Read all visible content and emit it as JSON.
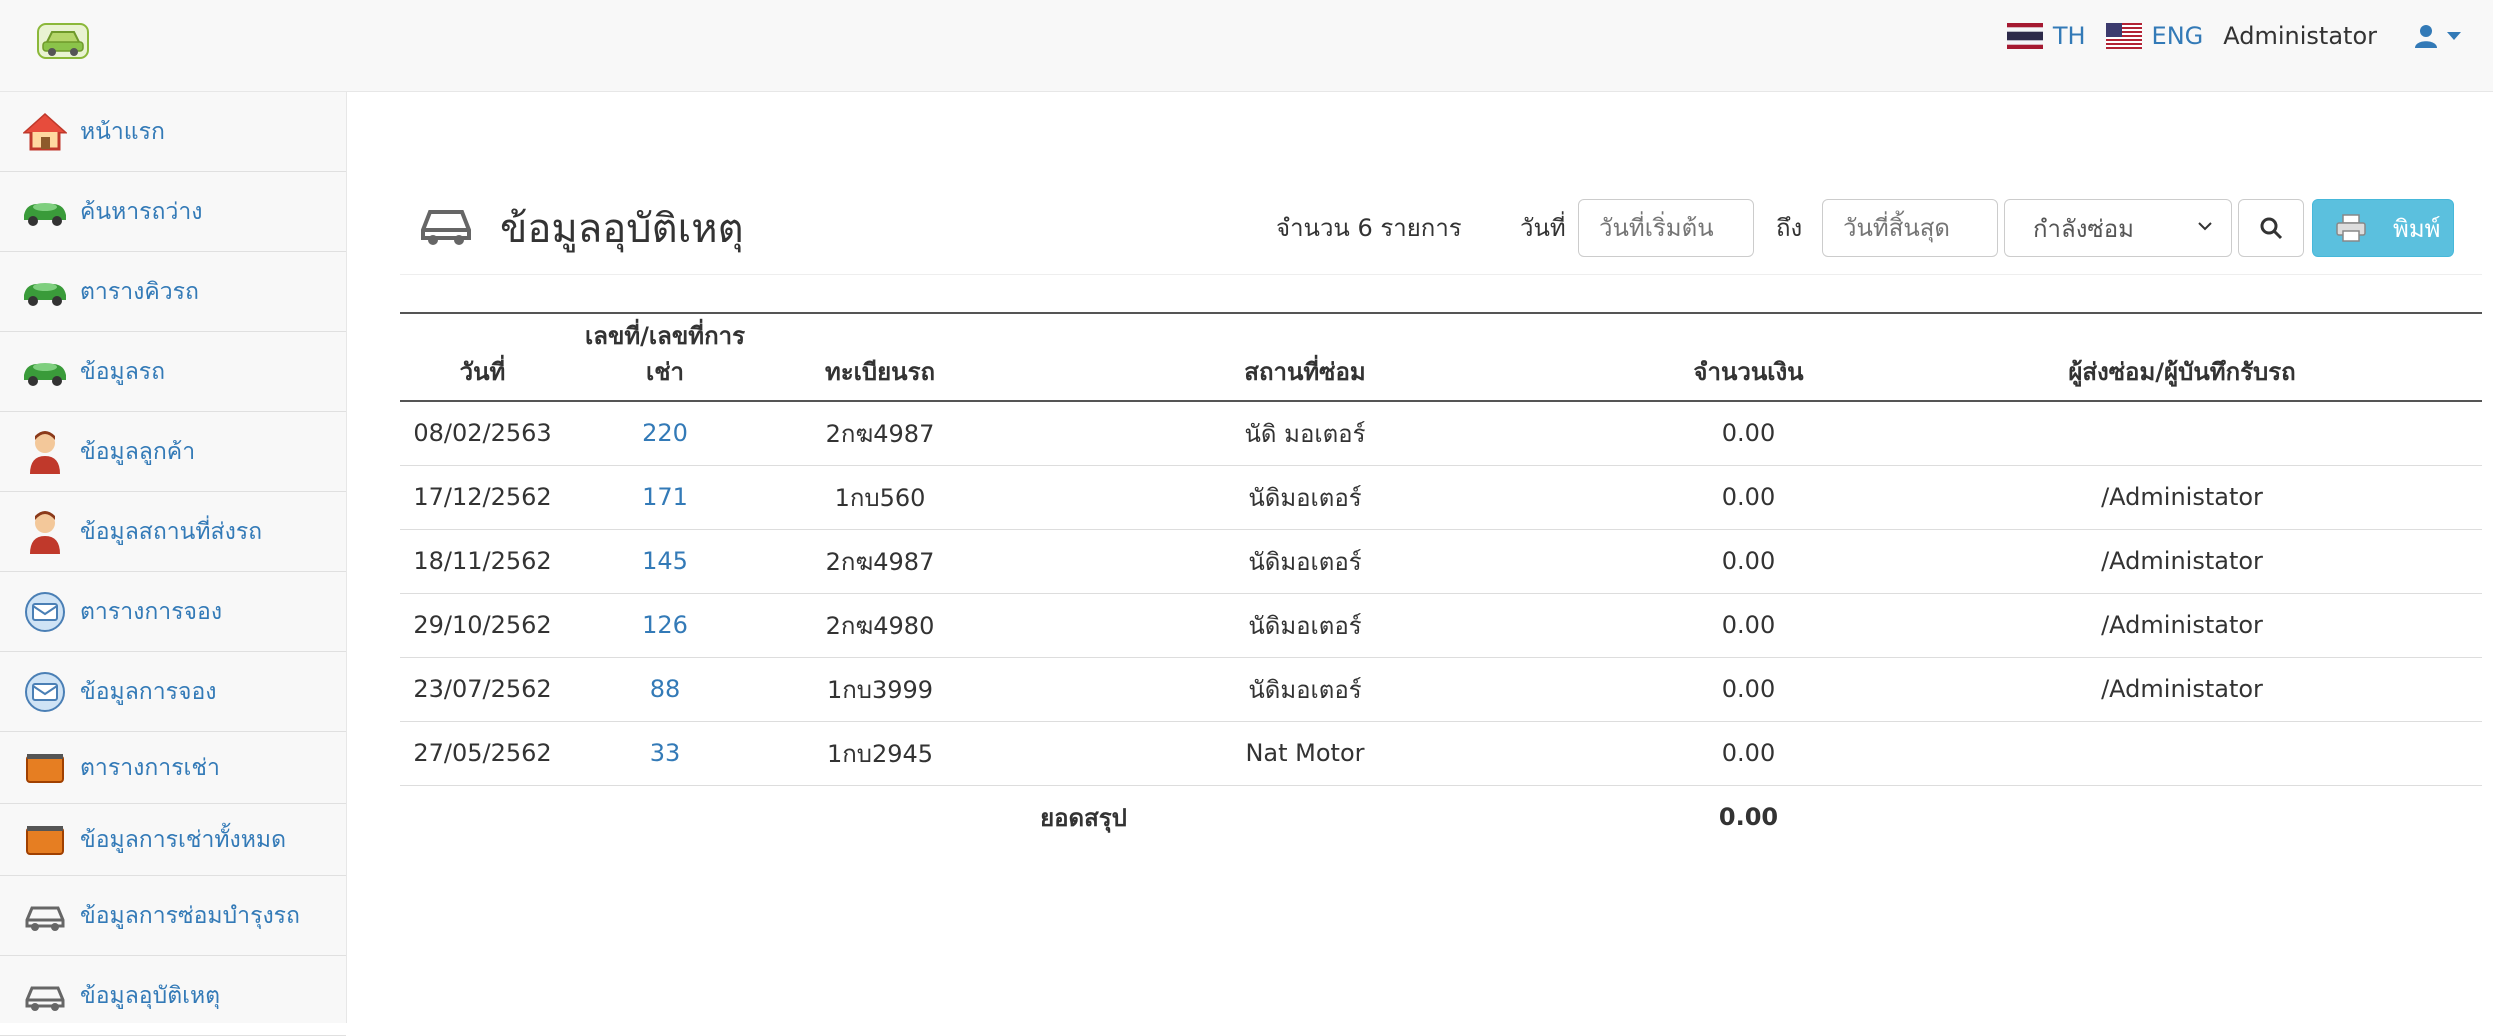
{
  "header": {
    "lang_th": "TH",
    "lang_en": "ENG",
    "user_name": "Administator"
  },
  "sidebar": {
    "items": [
      {
        "label": "หน้าแรก",
        "icon": "home-icon"
      },
      {
        "label": "ค้นหารถว่าง",
        "icon": "car-green-icon"
      },
      {
        "label": "ตารางคิวรถ",
        "icon": "car-green-icon"
      },
      {
        "label": "ข้อมูลรถ",
        "icon": "car-green-icon"
      },
      {
        "label": "ข้อมูลลูกค้า",
        "icon": "person-icon"
      },
      {
        "label": "ข้อมูลสถานที่ส่งรถ",
        "icon": "person-icon"
      },
      {
        "label": "ตารางการจอง",
        "icon": "booking-icon"
      },
      {
        "label": "ข้อมูลการจอง",
        "icon": "booking-icon"
      },
      {
        "label": "ตารางการเช่า",
        "icon": "rent-icon"
      },
      {
        "label": "ข้อมูลการเช่าทั้งหมด",
        "icon": "rent-icon"
      },
      {
        "label": "ข้อมูลการซ่อมบำรุงรถ",
        "icon": "car-outline-icon"
      },
      {
        "label": "ข้อมูลอุบัติเหตุ",
        "icon": "car-outline-icon"
      }
    ]
  },
  "page": {
    "title": "ข้อมูลอุบัติเหตุ",
    "count_text": "จำนวน  6  รายการ",
    "from_label": "วันที่",
    "from_placeholder": "วันที่เริ่มต้น",
    "to_label": "ถึง",
    "to_placeholder": "วันที่สิ้นสุด",
    "status_value": "กำลังซ่อม",
    "print_label": "พิมพ์"
  },
  "table": {
    "columns": [
      "วันที่",
      "เลขที่/เลขที่การเช่า",
      "ทะเบียนรถ",
      "สถานที่ซ่อม",
      "จำนวนเงิน",
      "ผู้ส่งซ่อม/ผู้บันทึกรับรถ"
    ],
    "col_no_line1": "เลขที่/เลขที่การ",
    "col_no_line2": "เช่า",
    "rows": [
      {
        "date": "08/02/2563",
        "no": "220",
        "plate": "2กฆ4987",
        "place": "นัดิ มอเตอร์",
        "amount": "0.00",
        "person": ""
      },
      {
        "date": "17/12/2562",
        "no": "171",
        "plate": "1กบ560",
        "place": "นัดิมอเตอร์",
        "amount": "0.00",
        "person": "/Administator"
      },
      {
        "date": "18/11/2562",
        "no": "145",
        "plate": "2กฆ4987",
        "place": "นัดิมอเตอร์",
        "amount": "0.00",
        "person": "/Administator"
      },
      {
        "date": "29/10/2562",
        "no": "126",
        "plate": "2กฆ4980",
        "place": "นัดิมอเตอร์",
        "amount": "0.00",
        "person": "/Administator"
      },
      {
        "date": "23/07/2562",
        "no": "88",
        "plate": "1กบ3999",
        "place": "นัดิมอเตอร์",
        "amount": "0.00",
        "person": "/Administator"
      },
      {
        "date": "27/05/2562",
        "no": "33",
        "plate": "1กบ2945",
        "place": "Nat Motor",
        "amount": "0.00",
        "person": ""
      }
    ],
    "summary_label": "ยอดสรุป",
    "summary_total": "0.00"
  }
}
